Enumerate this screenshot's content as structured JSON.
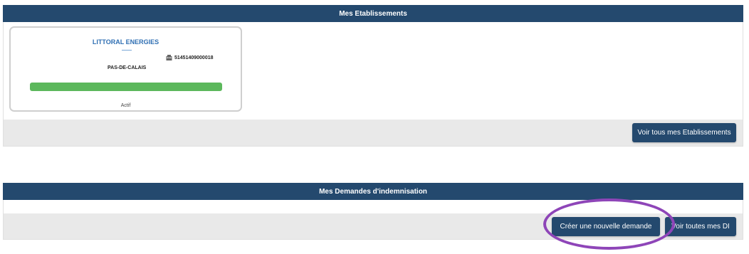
{
  "etablissements": {
    "header": "Mes Etablissements",
    "card": {
      "title": "LITTORAL ENERGIES",
      "siret": "51451409000018",
      "department": "PAS-DE-CALAIS",
      "status": "Actif",
      "status_color": "#5cb85c",
      "icon": "building-icon"
    },
    "view_all_label": "Voir tous mes Etablissements"
  },
  "demandes": {
    "header": "Mes Demandes d'indemnisation",
    "create_label": "Créer une nouvelle demande",
    "view_all_label": "Voir toutes mes DI"
  },
  "colors": {
    "primary": "#24496e",
    "footer": "#e9e9e9",
    "accent_title": "#2f6fb3",
    "annotation": "#8e45b8"
  }
}
